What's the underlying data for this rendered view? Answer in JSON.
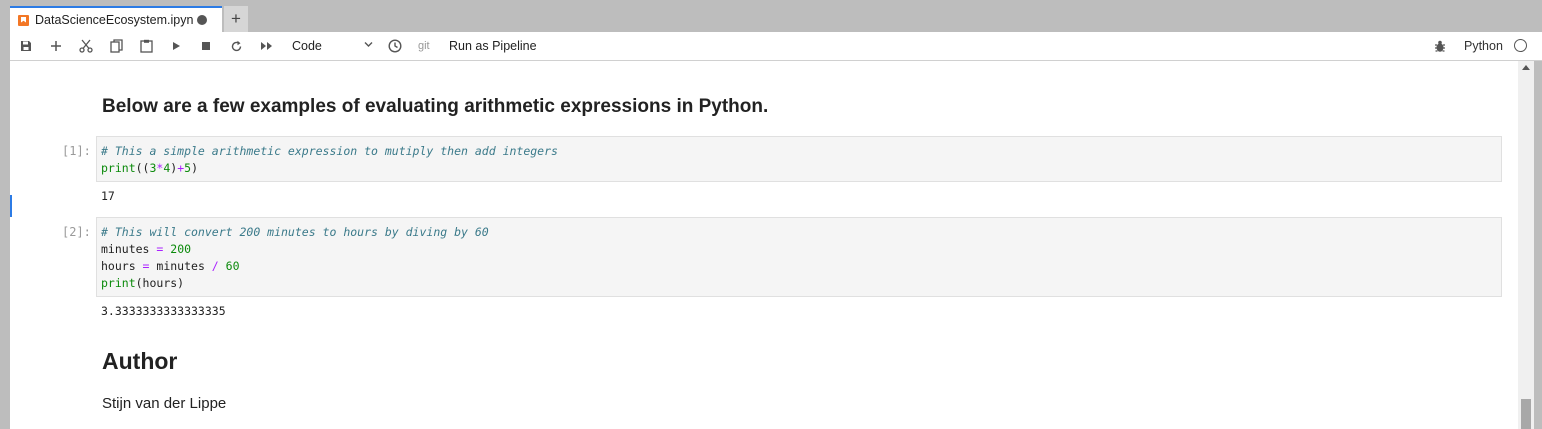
{
  "tab": {
    "title": "DataScienceEcosystem.ipyn"
  },
  "toolbar": {
    "cell_type": "Code",
    "git_label": "git",
    "pipeline_label": "Run as Pipeline",
    "kernel_name": "Python"
  },
  "notebook": {
    "intro_heading": "Below are a few examples of evaluating arithmetic expressions in Python.",
    "cells": [
      {
        "prompt": "[1]:",
        "code": [
          [
            {
              "t": "# This a simple arithmetic expression to mutiply then add integers",
              "c": "cm"
            }
          ],
          [
            {
              "t": "print",
              "c": "kw"
            },
            {
              "t": "((",
              "c": ""
            },
            {
              "t": "3",
              "c": "num"
            },
            {
              "t": "*",
              "c": "op"
            },
            {
              "t": "4",
              "c": "num"
            },
            {
              "t": ")",
              "c": ""
            },
            {
              "t": "+",
              "c": "op"
            },
            {
              "t": "5",
              "c": "num"
            },
            {
              "t": ")",
              "c": ""
            }
          ]
        ],
        "output": "17"
      },
      {
        "prompt": "[2]:",
        "code": [
          [
            {
              "t": "# This will convert 200 minutes to hours by diving by 60",
              "c": "cm"
            }
          ],
          [
            {
              "t": "minutes ",
              "c": ""
            },
            {
              "t": "=",
              "c": "op"
            },
            {
              "t": " ",
              "c": ""
            },
            {
              "t": "200",
              "c": "num"
            }
          ],
          [
            {
              "t": "hours ",
              "c": ""
            },
            {
              "t": "=",
              "c": "op"
            },
            {
              "t": " minutes ",
              "c": ""
            },
            {
              "t": "/",
              "c": "op"
            },
            {
              "t": " ",
              "c": ""
            },
            {
              "t": "60",
              "c": "num"
            }
          ],
          [
            {
              "t": "print",
              "c": "kw"
            },
            {
              "t": "(hours)",
              "c": ""
            }
          ]
        ],
        "output": "3.3333333333333335"
      }
    ],
    "author_heading": "Author",
    "author_name": "Stijn van der Lippe"
  },
  "colors": {
    "accent": "#2c7be5",
    "tab_icon": "#f37726"
  }
}
